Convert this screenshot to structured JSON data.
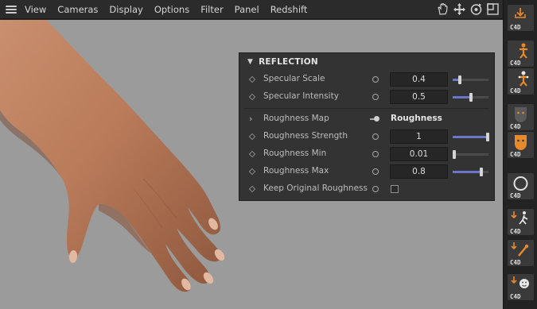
{
  "menu": {
    "items": [
      "View",
      "Cameras",
      "Display",
      "Options",
      "Filter",
      "Panel",
      "Redshift"
    ]
  },
  "viewport_icons": [
    "hand-pan-icon",
    "move-arrows-icon",
    "orbit-icon",
    "maximize-view-icon"
  ],
  "panel": {
    "title": "REFLECTION",
    "rows": [
      {
        "label": "Specular Scale",
        "value": "0.4",
        "slider": 0.2
      },
      {
        "label": "Specular Intensity",
        "value": "0.5",
        "slider": 0.5
      },
      {
        "label": "Roughness Map",
        "map": "Roughness"
      },
      {
        "label": "Roughness Strength",
        "value": "1",
        "slider": 1.0
      },
      {
        "label": "Roughness Min",
        "value": "0.01",
        "slider": 0.01
      },
      {
        "label": "Roughness Max",
        "value": "0.8",
        "slider": 0.8
      },
      {
        "label": "Keep Original Roughness",
        "checked": false
      }
    ]
  },
  "toolbar": {
    "tools": [
      {
        "name": "c4d-import-tool",
        "badge": "C4D"
      },
      {
        "name": "c4d-figure-tool",
        "badge": "C4D"
      },
      {
        "name": "c4d-rig-tool",
        "badge": "C4D"
      },
      {
        "name": "c4d-face-dark-tool",
        "badge": "C4D"
      },
      {
        "name": "c4d-face-skin-tool",
        "badge": "C4D"
      },
      {
        "name": "c4d-sphere-tool",
        "badge": "C4D"
      },
      {
        "name": "c4d-walk-tool",
        "badge": "C4D"
      },
      {
        "name": "c4d-brush-tool",
        "badge": "C4D"
      },
      {
        "name": "c4d-smiley-tool",
        "badge": "C4D"
      }
    ]
  },
  "colors": {
    "slider_fill": "#6d75c9",
    "accent_orange": "#e8892c",
    "viewport_bg": "#9b9b9b",
    "panel_bg": "#333333"
  }
}
